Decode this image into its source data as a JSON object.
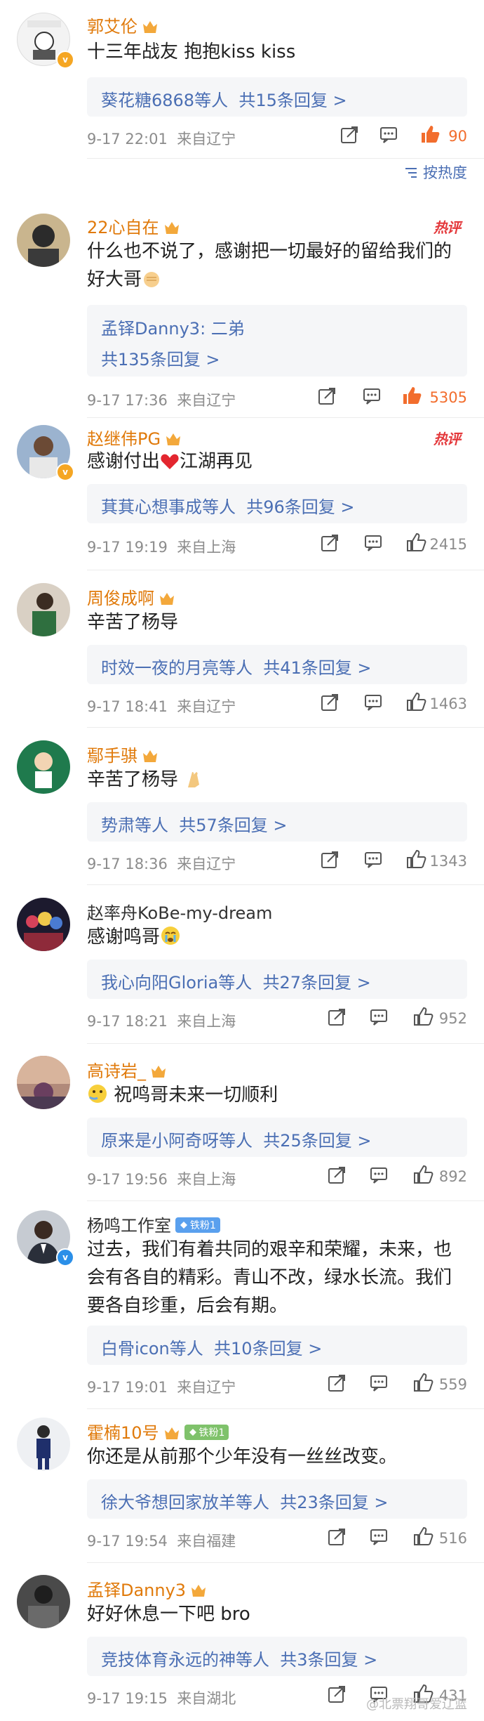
{
  "sort": {
    "label": "按热度"
  },
  "watermark": "@北票翔哥爱辽篮",
  "hot_label": "热评",
  "comments": [
    {
      "name": "郭艾伦",
      "text": "十三年战友 抱抱kiss kiss",
      "reply_summary": "葵花糖6868等人",
      "reply_count": "共15条回复 >",
      "time": "9-17 22:01",
      "location": "来自辽宁",
      "likes": "90"
    },
    {
      "name": "22心自在",
      "text": "什么也不说了，感谢把一切最好的留给我们的好大哥",
      "reply_first": "孟铎Danny3: 二弟",
      "reply_count": "共135条回复 >",
      "time": "9-17 17:36",
      "location": "来自辽宁",
      "likes": "5305"
    },
    {
      "name": "赵继伟PG",
      "text_before": "感谢付出",
      "text_after": "江湖再见",
      "reply_summary": "萁萁心想事成等人",
      "reply_count": "共96条回复 >",
      "time": "9-17 19:19",
      "location": "来自上海",
      "likes": "2415"
    },
    {
      "name": "周俊成啊",
      "text": "辛苦了杨导",
      "reply_summary": "时效一夜的月亮等人",
      "reply_count": "共41条回复 >",
      "time": "9-17 18:41",
      "location": "来自辽宁",
      "likes": "1463"
    },
    {
      "name": "鄢手骐",
      "text": "辛苦了杨导",
      "reply_summary": "势肃等人",
      "reply_count": "共57条回复 >",
      "time": "9-17 18:36",
      "location": "来自辽宁",
      "likes": "1343"
    },
    {
      "name": "赵率舟KoBe-my-dream",
      "text": "感谢鸣哥",
      "reply_summary": "我心向阳Gloria等人",
      "reply_count": "共27条回复 >",
      "time": "9-17 18:21",
      "location": "来自上海",
      "likes": "952"
    },
    {
      "name": "高诗岩_",
      "text": "祝鸣哥未来一切顺利",
      "reply_summary": "原来是小阿奇呀等人",
      "reply_count": "共25条回复 >",
      "time": "9-17 19:56",
      "location": "来自上海",
      "likes": "892"
    },
    {
      "name": "杨鸣工作室",
      "badge": "铁粉1",
      "text": "过去，我们有着共同的艰辛和荣耀，未来，也会有各自的精彩。青山不改，绿水长流。我们要各自珍重，后会有期。",
      "reply_summary": "白骨icon等人",
      "reply_count": "共10条回复 >",
      "time": "9-17 19:01",
      "location": "来自辽宁",
      "likes": "559"
    },
    {
      "name": "霍楠10号",
      "badge": "铁粉1",
      "text": "你还是从前那个少年没有一丝丝改变。",
      "reply_summary": "徐大爷想回家放羊等人",
      "reply_count": "共23条回复 >",
      "time": "9-17 19:54",
      "location": "来自福建",
      "likes": "516"
    },
    {
      "name": "孟铎Danny3",
      "text": "好好休息一下吧 bro",
      "reply_summary": "竞技体育永远的神等人",
      "reply_count": "共3条回复 >",
      "time": "9-17 19:15",
      "location": "来自湖北",
      "likes": "431"
    }
  ],
  "colors": {
    "name": "#e07a0b",
    "name_plain": "#333333",
    "link": "#4b6fb4",
    "hot": "#e4393c",
    "like_active": "#f26d2d",
    "meta": "#8c8c8c"
  }
}
